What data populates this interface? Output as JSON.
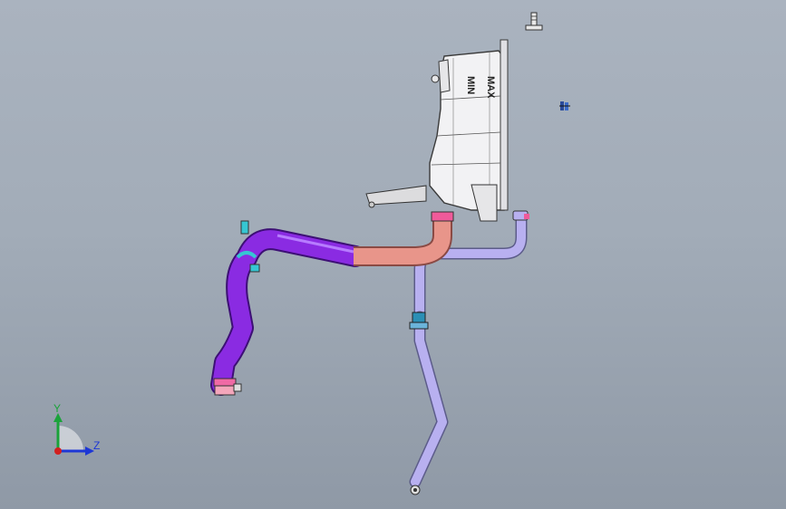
{
  "viewport": {
    "background_top": "#aab3bf",
    "background_bottom": "#8f99a6"
  },
  "tank": {
    "label_min": "MIN",
    "label_max": "MAX",
    "body_color": "#f2f2f4",
    "outline_color": "#3a3a3a"
  },
  "hoses": {
    "purple_color": "#8a2be2",
    "salmon_color": "#e8958a",
    "lavender_color": "#b8b0f0",
    "clamp_pink": "#f05a9a",
    "clamp_cyan": "#36c6d2"
  },
  "triad": {
    "y_label": "Y",
    "z_label": "Z",
    "y_color": "#1aa33a",
    "z_color": "#1d37d6",
    "origin_color": "#d21f1f"
  },
  "icons": [
    "bolt-icon",
    "small-part-icon",
    "triad-icon"
  ]
}
